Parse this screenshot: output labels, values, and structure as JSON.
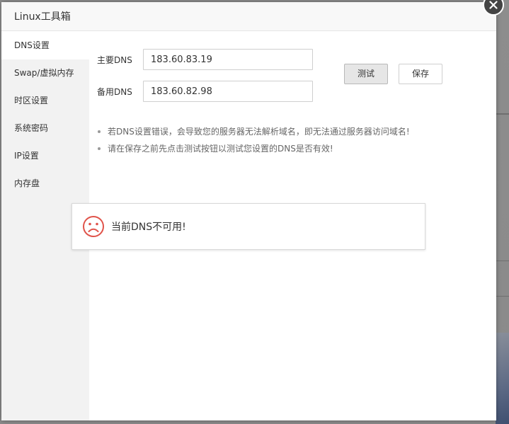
{
  "dialog": {
    "title": "Linux工具箱"
  },
  "sidebar": {
    "items": [
      {
        "label": "DNS设置",
        "active": true
      },
      {
        "label": "Swap/虚拟内存",
        "active": false
      },
      {
        "label": "时区设置",
        "active": false
      },
      {
        "label": "系统密码",
        "active": false
      },
      {
        "label": "IP设置",
        "active": false
      },
      {
        "label": "内存盘",
        "active": false
      }
    ]
  },
  "dns": {
    "primary_label": "主要DNS",
    "primary_value": "183.60.83.19",
    "secondary_label": "备用DNS",
    "secondary_value": "183.60.82.98",
    "test_label": "测试",
    "save_label": "保存"
  },
  "tips": [
    "若DNS设置错误，会导致您的服务器无法解析域名，即无法通过服务器访问域名!",
    "请在保存之前先点击测试按钮以测试您设置的DNS是否有效!"
  ],
  "toast": {
    "message": "当前DNS不可用!",
    "icon": "sad-face-icon"
  },
  "colors": {
    "error": "#e0534a",
    "sidebar_bg": "#f2f2f2",
    "header_bg": "#f8f8f8"
  }
}
